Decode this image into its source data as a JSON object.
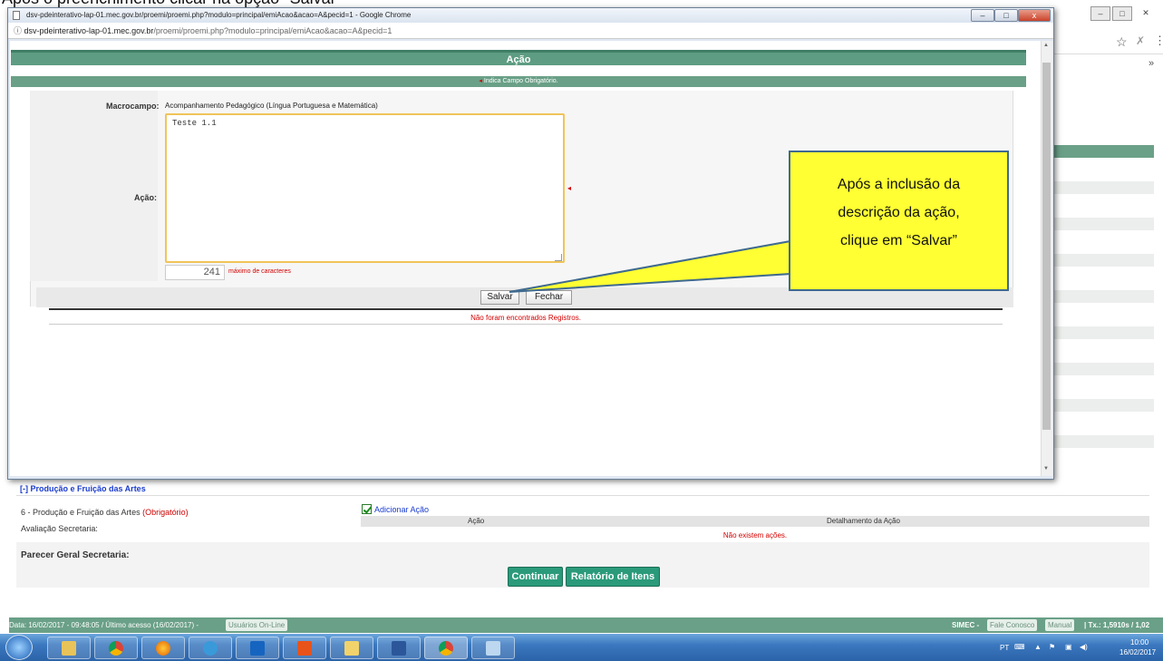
{
  "caption": "Após o preenchimento clicar na opção \"Salvar\"",
  "popup": {
    "title": "dsv-pdeinterativo-lap-01.mec.gov.br/proemi/proemi.php?modulo=principal/emiAcao&acao=A&pecid=1 - Google Chrome",
    "address_host": "dsv-pdeinterativo-lap-01.mec.gov.br",
    "address_path": "/proemi/proemi.php?modulo=principal/emiAcao&acao=A&pecid=1",
    "close_label": "x",
    "min_label": "–",
    "max_label": "□"
  },
  "form": {
    "header": "Ação",
    "required_note": "Indica Campo Obrigatório.",
    "macro_label": "Macrocampo:",
    "macro_value": "Acompanhamento Pedagógico (Língua Portuguesa e Matemática)",
    "acao_label": "Ação:",
    "acao_value": "Teste 1.1",
    "counter_value": "241",
    "counter_label": "máximo de caracteres",
    "save_label": "Salvar",
    "close_label": "Fechar",
    "no_records": "Não foram encontrados Registros."
  },
  "callout": {
    "line1": "Após a inclusão da",
    "line2": "descrição da ação,",
    "line3": "clique em “Salvar”"
  },
  "page": {
    "section_title": "[-]  Produção e Fruição das Artes",
    "row_label": "6 - Produção e Fruição das Artes",
    "row_required": "(Obrigatório)",
    "aval_label": "Avaliação Secretaria:",
    "add_acao": "Adicionar Ação",
    "col_acao": "Ação",
    "col_detalhe": "Detalhamento da Ação",
    "no_actions": "Não existem ações.",
    "parecer_label": "Parecer Geral Secretaria:",
    "continuar": "Continuar",
    "relatorio": "Relatório de Itens"
  },
  "footer": {
    "left_text": "Data: 16/02/2017 - 09:48:05 / Último acesso (16/02/2017) -",
    "online_btn": "Usuários On-Line",
    "simec": "SIMEC -",
    "fale": "Fale Conosco",
    "manual": "Manual",
    "tx": "| Tx.: 1,5910s / 1,02"
  },
  "taskbar": {
    "lang": "PT",
    "time": "10:00",
    "date": "16/02/2017"
  },
  "colors": {
    "green_header": "#5e9d83",
    "required_red": "#d40000",
    "callout_yellow": "#ffff33"
  }
}
